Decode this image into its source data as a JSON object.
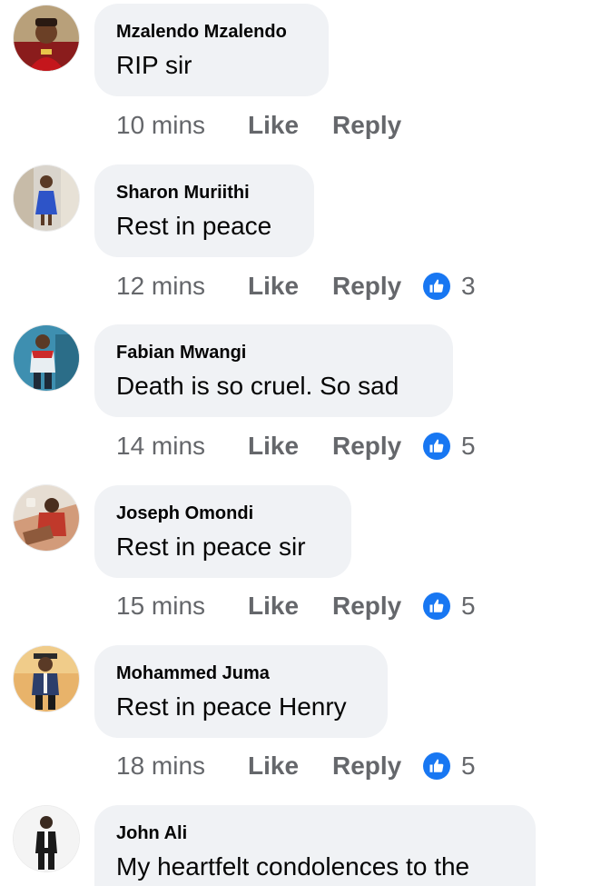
{
  "comments": [
    {
      "name": "Mzalendo Mzalendo",
      "text": "RIP sir",
      "time": "10 mins",
      "like": "Like",
      "reply": "Reply",
      "reaction_count": ""
    },
    {
      "name": "Sharon Muriithi",
      "text": "Rest in peace",
      "time": "12 mins",
      "like": "Like",
      "reply": "Reply",
      "reaction_count": "3"
    },
    {
      "name": "Fabian Mwangi",
      "text": "Death is so cruel. So sad",
      "time": "14 mins",
      "like": "Like",
      "reply": "Reply",
      "reaction_count": "5"
    },
    {
      "name": "Joseph Omondi",
      "text": "Rest in peace sir",
      "time": "15 mins",
      "like": "Like",
      "reply": "Reply",
      "reaction_count": "5"
    },
    {
      "name": "Mohammed Juma",
      "text": "Rest in peace Henry",
      "time": "18 mins",
      "like": "Like",
      "reply": "Reply",
      "reaction_count": "5"
    },
    {
      "name": "John Ali",
      "text": "My heartfelt condolences to the",
      "time": "",
      "like": "",
      "reply": "",
      "reaction_count": ""
    }
  ],
  "colors": {
    "bubble": "#f0f2f5",
    "text": "#050505",
    "meta": "#65676b",
    "like_badge": "#1877f2"
  },
  "icons": {
    "reaction": "thumbs-up-icon",
    "avatar": "user-avatar"
  }
}
